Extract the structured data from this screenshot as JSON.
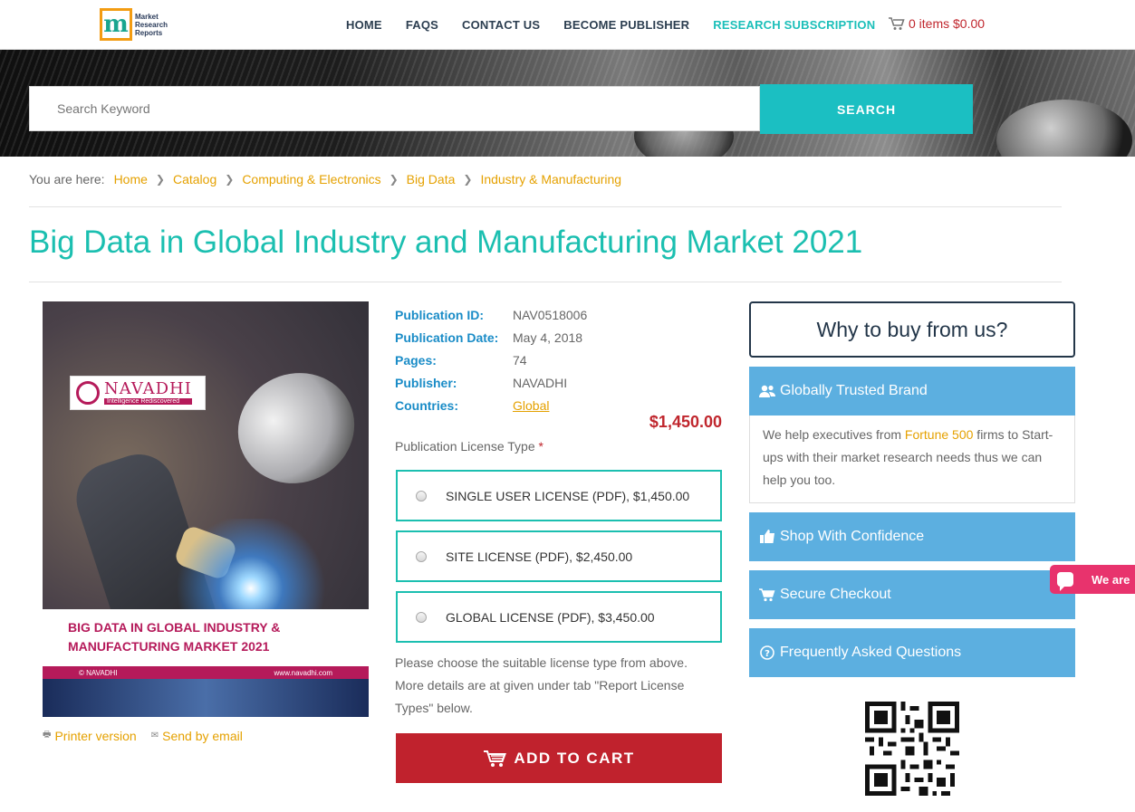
{
  "header": {
    "logo_text": [
      "Market",
      "Research",
      "Reports"
    ],
    "logo_letter": "m",
    "nav": [
      {
        "label": "HOME"
      },
      {
        "label": "FAQS"
      },
      {
        "label": "CONTACT US"
      },
      {
        "label": "BECOME PUBLISHER"
      },
      {
        "label": "RESEARCH SUBSCRIPTION"
      }
    ],
    "cart": "0 items $0.00"
  },
  "search": {
    "placeholder": "Search Keyword",
    "button": "SEARCH"
  },
  "breadcrumb": {
    "label": "You are here:",
    "items": [
      "Home",
      "Catalog",
      "Computing & Electronics",
      "Big Data",
      "Industry & Manufacturing"
    ]
  },
  "title": "Big Data in Global Industry and Manufacturing Market 2021",
  "cover": {
    "brand": "NAVADHI",
    "tagline": "Intelligence Rediscovered",
    "title_line1": "BIG DATA IN GLOBAL INDUSTRY &",
    "title_line2": "MANUFACTURING MARKET 2021",
    "footer_left": "© NAVADHI",
    "footer_right": "www.navadhi.com"
  },
  "links": {
    "printer": "Printer version",
    "email": "Send by email"
  },
  "details": [
    {
      "label": "Publication ID:",
      "value": "NAV0518006"
    },
    {
      "label": "Publication Date:",
      "value": "May 4, 2018"
    },
    {
      "label": "Pages:",
      "value": "74"
    },
    {
      "label": "Publisher:",
      "value": "NAVADHI"
    },
    {
      "label": "Countries:",
      "value": "Global"
    }
  ],
  "price": "$1,450.00",
  "license": {
    "label": "Publication License Type",
    "required_mark": "*",
    "options": [
      "SINGLE USER LICENSE (PDF), $1,450.00",
      "SITE LICENSE (PDF), $2,450.00",
      "GLOBAL LICENSE (PDF), $3,450.00"
    ],
    "note": "Please choose the suitable license type from above. More details are at given under tab \"Report License Types\" below."
  },
  "add_to_cart": "ADD TO CART",
  "sidebar": {
    "why": "Why to buy from us?",
    "trusted_title": "Globally Trusted Brand",
    "trusted_pre": "We help executives from ",
    "trusted_link": "Fortune 500",
    "trusted_post": " firms to Start-ups with their market research needs thus we can help you too.",
    "confidence": "Shop With Confidence",
    "secure": "Secure Checkout",
    "faq": "Frequently Asked Questions"
  },
  "chat": "We are",
  "colors": {
    "accent_teal": "#1bbfb0",
    "link_orange": "#e5a100",
    "cart_red": "#c0262d",
    "info_blue": "#5cafe0"
  }
}
